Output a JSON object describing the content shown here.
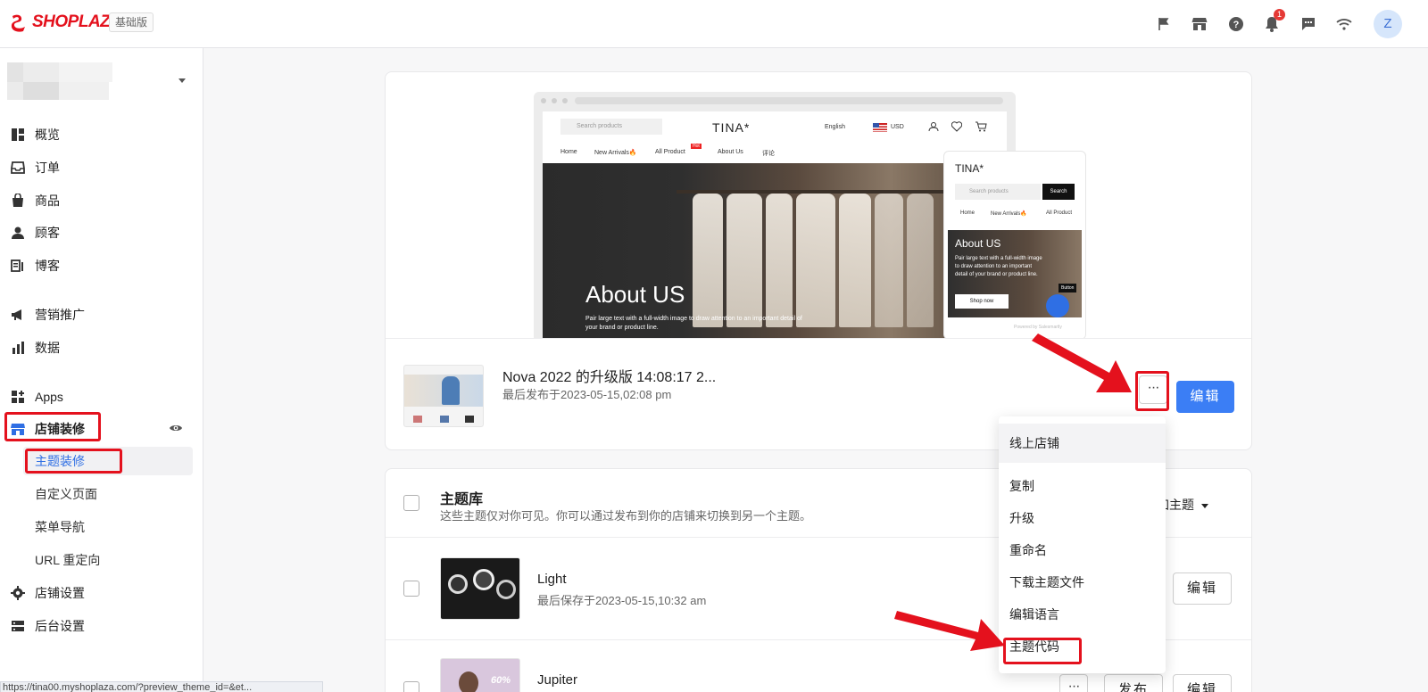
{
  "header": {
    "logo_text": "SHOPLAZZA",
    "plan_badge": "基础版",
    "notification_count": "1",
    "avatar_initial": "Z",
    "brand_color": "#e4111d"
  },
  "sidebar": {
    "nav_items": [
      {
        "label": "概览",
        "icon": "dashboard-icon"
      },
      {
        "label": "订单",
        "icon": "inbox-icon"
      },
      {
        "label": "商品",
        "icon": "bag-icon"
      },
      {
        "label": "顾客",
        "icon": "person-icon"
      },
      {
        "label": "博客",
        "icon": "blog-icon"
      },
      {
        "label": "营销推广",
        "icon": "megaphone-icon"
      },
      {
        "label": "数据",
        "icon": "bar-chart-icon"
      },
      {
        "label": "Apps",
        "icon": "apps-icon"
      },
      {
        "label": "店铺装修",
        "icon": "store-icon"
      }
    ],
    "sub_items": [
      "主题装修",
      "自定义页面",
      "菜单导航",
      "URL 重定向"
    ],
    "bottom_items": [
      {
        "label": "店铺设置",
        "icon": "gear-icon"
      },
      {
        "label": "后台设置",
        "icon": "server-icon"
      }
    ],
    "active_sub": "主题装修",
    "accent_color": "#2f6fe4"
  },
  "current_theme": {
    "preview": {
      "site_search": "Search products",
      "site_logo": "TINA*",
      "language": "English",
      "currency": "USD",
      "nav": [
        "Home",
        "New Arrivals🔥",
        "All Product",
        "About Us",
        "评论"
      ],
      "hot_badge": "Hot",
      "hero_title": "About US",
      "hero_sub": "Pair large text with a full-width image to draw attention to an important detail of your brand or product line.",
      "mobile_search_btn": "Search",
      "mobile_nav": [
        "Home",
        "New Arrivals🔥",
        "All Product"
      ],
      "mobile_hero_sub": "Pair large text with a full-width image to draw attention to an important detail of your brand or product line.",
      "mobile_shop_now": "Shop now",
      "mobile_button": "Button",
      "powered_by": "Powered by Salesmartly"
    },
    "name": "Nova 2022 的升级版 14:08:17 2...",
    "published": "最后发布于2023-05-15,02:08 pm",
    "more_label": "···",
    "edit_label": "编辑"
  },
  "dropdown": {
    "header": "线上店铺",
    "items": [
      "复制",
      "升级",
      "重命名",
      "下载主题文件",
      "编辑语言",
      "主题代码"
    ]
  },
  "library": {
    "title": "主题库",
    "description": "这些主题仅对你可见。你可以通过发布到你的店铺来切换到另一个主题。",
    "add_theme": "添加主题",
    "themes": [
      {
        "name": "Light",
        "saved": "最后保存于2023-05-15,10:32 am",
        "edit_label": "编辑"
      },
      {
        "name": "Jupiter",
        "more_label": "···",
        "publish_label": "发布",
        "edit_label": "编辑",
        "thumb_text": "60%"
      }
    ]
  },
  "status_url": "https://tina00.myshoplaza.com/?preview_theme_id=&et..."
}
